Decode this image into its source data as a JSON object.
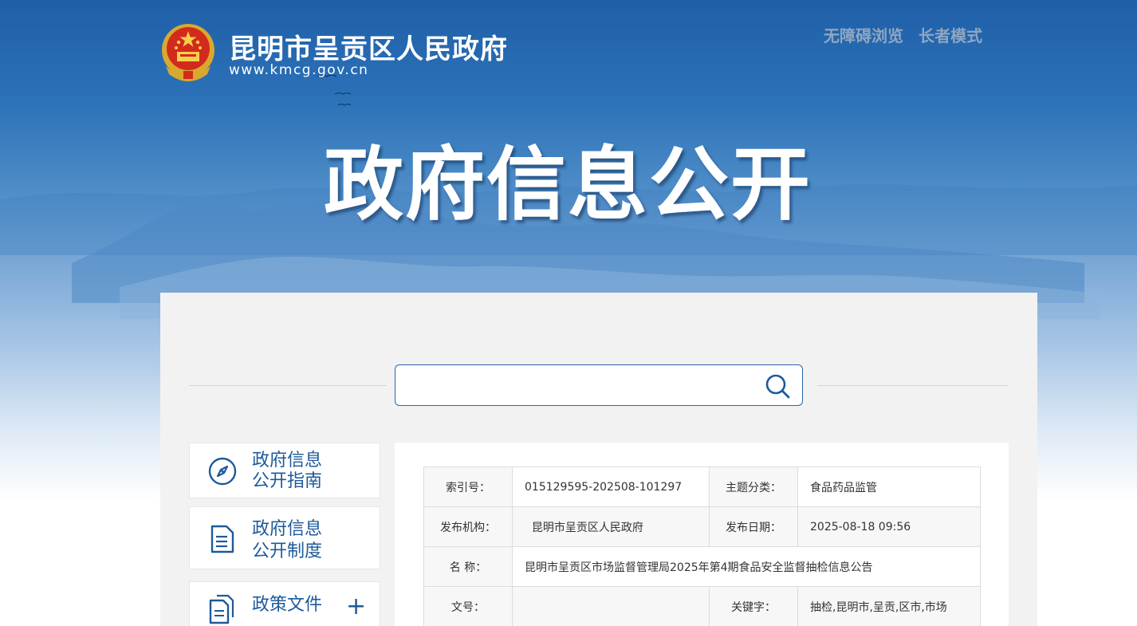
{
  "header": {
    "site_name": "昆明市呈贡区人民政府",
    "site_url": "www.kmcg.gov.cn",
    "links": [
      "无障碍浏览",
      "长者模式"
    ],
    "hero_title": "政府信息公开"
  },
  "search": {
    "placeholder": "",
    "value": ""
  },
  "sidebar": {
    "items": [
      {
        "label_line1": "政府信息",
        "label_line2": "公开指南",
        "icon": "compass-icon"
      },
      {
        "label_line1": "政府信息",
        "label_line2": "公开制度",
        "icon": "document-icon"
      },
      {
        "label_line1": "政策文件",
        "icon": "files-icon",
        "expand": "+"
      }
    ]
  },
  "meta": {
    "rows": [
      {
        "k1": "索引号：",
        "v1": "015129595-202508-101297",
        "k2": "主题分类：",
        "v2": "食品药品监管"
      },
      {
        "k1": "发布机构：",
        "v1": "  昆明市呈贡区人民政府",
        "k2": "发布日期：",
        "v2": "2025-08-18 09:56"
      },
      {
        "k1": "名 称：",
        "v1": "昆明市呈贡区市场监督管理局2025年第4期食品安全监督抽检信息公告"
      },
      {
        "k1": "文号：",
        "v1": "",
        "k2": "关键字：",
        "v2": "抽检,昆明市,呈贡,区市,市场"
      }
    ]
  },
  "colors": {
    "accent": "#1d5a9a",
    "banner_top": "#1f5fa8",
    "panel_bg": "#f2f2f2"
  }
}
